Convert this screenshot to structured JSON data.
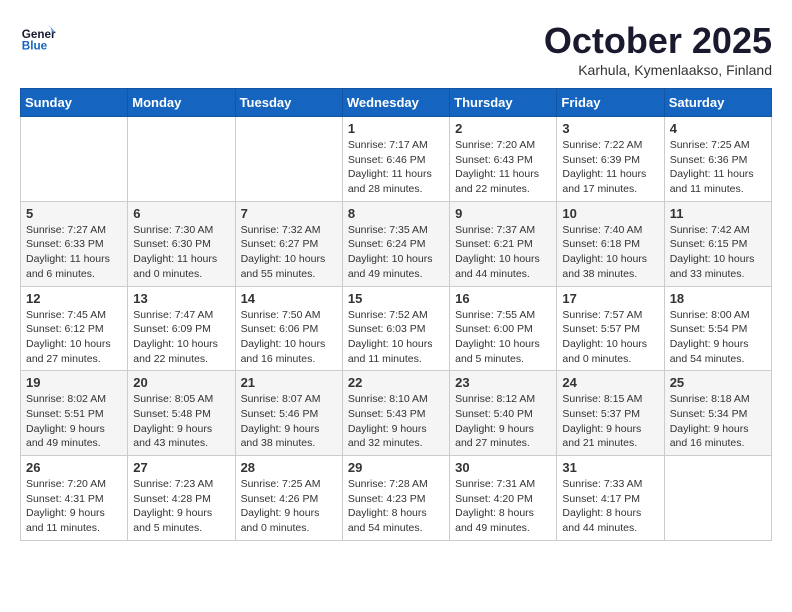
{
  "header": {
    "logo_general": "General",
    "logo_blue": "Blue",
    "month_title": "October 2025",
    "location": "Karhula, Kymenlaakso, Finland"
  },
  "weekdays": [
    "Sunday",
    "Monday",
    "Tuesday",
    "Wednesday",
    "Thursday",
    "Friday",
    "Saturday"
  ],
  "weeks": [
    [
      {
        "day": "",
        "sunrise": "",
        "sunset": "",
        "daylight": ""
      },
      {
        "day": "",
        "sunrise": "",
        "sunset": "",
        "daylight": ""
      },
      {
        "day": "",
        "sunrise": "",
        "sunset": "",
        "daylight": ""
      },
      {
        "day": "1",
        "sunrise": "Sunrise: 7:17 AM",
        "sunset": "Sunset: 6:46 PM",
        "daylight": "Daylight: 11 hours and 28 minutes."
      },
      {
        "day": "2",
        "sunrise": "Sunrise: 7:20 AM",
        "sunset": "Sunset: 6:43 PM",
        "daylight": "Daylight: 11 hours and 22 minutes."
      },
      {
        "day": "3",
        "sunrise": "Sunrise: 7:22 AM",
        "sunset": "Sunset: 6:39 PM",
        "daylight": "Daylight: 11 hours and 17 minutes."
      },
      {
        "day": "4",
        "sunrise": "Sunrise: 7:25 AM",
        "sunset": "Sunset: 6:36 PM",
        "daylight": "Daylight: 11 hours and 11 minutes."
      }
    ],
    [
      {
        "day": "5",
        "sunrise": "Sunrise: 7:27 AM",
        "sunset": "Sunset: 6:33 PM",
        "daylight": "Daylight: 11 hours and 6 minutes."
      },
      {
        "day": "6",
        "sunrise": "Sunrise: 7:30 AM",
        "sunset": "Sunset: 6:30 PM",
        "daylight": "Daylight: 11 hours and 0 minutes."
      },
      {
        "day": "7",
        "sunrise": "Sunrise: 7:32 AM",
        "sunset": "Sunset: 6:27 PM",
        "daylight": "Daylight: 10 hours and 55 minutes."
      },
      {
        "day": "8",
        "sunrise": "Sunrise: 7:35 AM",
        "sunset": "Sunset: 6:24 PM",
        "daylight": "Daylight: 10 hours and 49 minutes."
      },
      {
        "day": "9",
        "sunrise": "Sunrise: 7:37 AM",
        "sunset": "Sunset: 6:21 PM",
        "daylight": "Daylight: 10 hours and 44 minutes."
      },
      {
        "day": "10",
        "sunrise": "Sunrise: 7:40 AM",
        "sunset": "Sunset: 6:18 PM",
        "daylight": "Daylight: 10 hours and 38 minutes."
      },
      {
        "day": "11",
        "sunrise": "Sunrise: 7:42 AM",
        "sunset": "Sunset: 6:15 PM",
        "daylight": "Daylight: 10 hours and 33 minutes."
      }
    ],
    [
      {
        "day": "12",
        "sunrise": "Sunrise: 7:45 AM",
        "sunset": "Sunset: 6:12 PM",
        "daylight": "Daylight: 10 hours and 27 minutes."
      },
      {
        "day": "13",
        "sunrise": "Sunrise: 7:47 AM",
        "sunset": "Sunset: 6:09 PM",
        "daylight": "Daylight: 10 hours and 22 minutes."
      },
      {
        "day": "14",
        "sunrise": "Sunrise: 7:50 AM",
        "sunset": "Sunset: 6:06 PM",
        "daylight": "Daylight: 10 hours and 16 minutes."
      },
      {
        "day": "15",
        "sunrise": "Sunrise: 7:52 AM",
        "sunset": "Sunset: 6:03 PM",
        "daylight": "Daylight: 10 hours and 11 minutes."
      },
      {
        "day": "16",
        "sunrise": "Sunrise: 7:55 AM",
        "sunset": "Sunset: 6:00 PM",
        "daylight": "Daylight: 10 hours and 5 minutes."
      },
      {
        "day": "17",
        "sunrise": "Sunrise: 7:57 AM",
        "sunset": "Sunset: 5:57 PM",
        "daylight": "Daylight: 10 hours and 0 minutes."
      },
      {
        "day": "18",
        "sunrise": "Sunrise: 8:00 AM",
        "sunset": "Sunset: 5:54 PM",
        "daylight": "Daylight: 9 hours and 54 minutes."
      }
    ],
    [
      {
        "day": "19",
        "sunrise": "Sunrise: 8:02 AM",
        "sunset": "Sunset: 5:51 PM",
        "daylight": "Daylight: 9 hours and 49 minutes."
      },
      {
        "day": "20",
        "sunrise": "Sunrise: 8:05 AM",
        "sunset": "Sunset: 5:48 PM",
        "daylight": "Daylight: 9 hours and 43 minutes."
      },
      {
        "day": "21",
        "sunrise": "Sunrise: 8:07 AM",
        "sunset": "Sunset: 5:46 PM",
        "daylight": "Daylight: 9 hours and 38 minutes."
      },
      {
        "day": "22",
        "sunrise": "Sunrise: 8:10 AM",
        "sunset": "Sunset: 5:43 PM",
        "daylight": "Daylight: 9 hours and 32 minutes."
      },
      {
        "day": "23",
        "sunrise": "Sunrise: 8:12 AM",
        "sunset": "Sunset: 5:40 PM",
        "daylight": "Daylight: 9 hours and 27 minutes."
      },
      {
        "day": "24",
        "sunrise": "Sunrise: 8:15 AM",
        "sunset": "Sunset: 5:37 PM",
        "daylight": "Daylight: 9 hours and 21 minutes."
      },
      {
        "day": "25",
        "sunrise": "Sunrise: 8:18 AM",
        "sunset": "Sunset: 5:34 PM",
        "daylight": "Daylight: 9 hours and 16 minutes."
      }
    ],
    [
      {
        "day": "26",
        "sunrise": "Sunrise: 7:20 AM",
        "sunset": "Sunset: 4:31 PM",
        "daylight": "Daylight: 9 hours and 11 minutes."
      },
      {
        "day": "27",
        "sunrise": "Sunrise: 7:23 AM",
        "sunset": "Sunset: 4:28 PM",
        "daylight": "Daylight: 9 hours and 5 minutes."
      },
      {
        "day": "28",
        "sunrise": "Sunrise: 7:25 AM",
        "sunset": "Sunset: 4:26 PM",
        "daylight": "Daylight: 9 hours and 0 minutes."
      },
      {
        "day": "29",
        "sunrise": "Sunrise: 7:28 AM",
        "sunset": "Sunset: 4:23 PM",
        "daylight": "Daylight: 8 hours and 54 minutes."
      },
      {
        "day": "30",
        "sunrise": "Sunrise: 7:31 AM",
        "sunset": "Sunset: 4:20 PM",
        "daylight": "Daylight: 8 hours and 49 minutes."
      },
      {
        "day": "31",
        "sunrise": "Sunrise: 7:33 AM",
        "sunset": "Sunset: 4:17 PM",
        "daylight": "Daylight: 8 hours and 44 minutes."
      },
      {
        "day": "",
        "sunrise": "",
        "sunset": "",
        "daylight": ""
      }
    ]
  ]
}
